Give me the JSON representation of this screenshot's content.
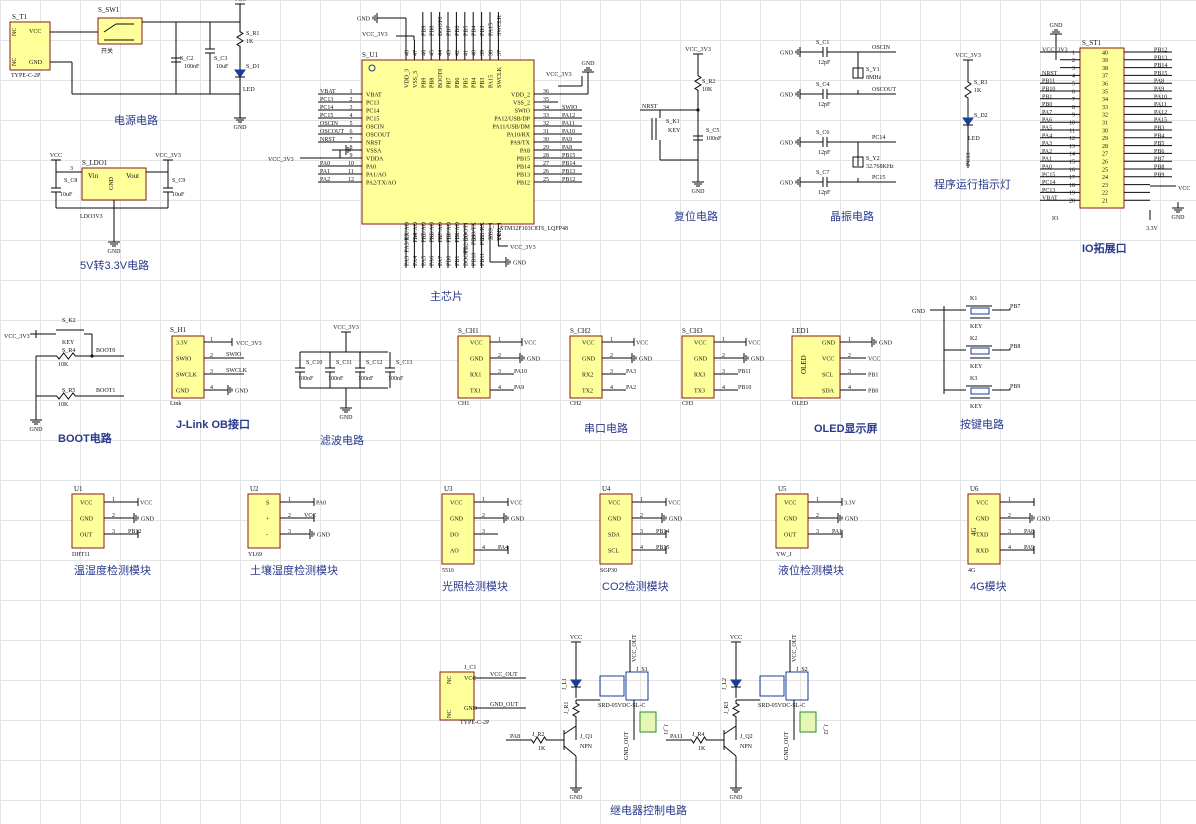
{
  "nets": {
    "vcc": "VCC",
    "vcc33": "VCC_3V3",
    "gnd": "GND",
    "v33": "3.3V",
    "vcc_out": "VCC_OUT",
    "gnd_out": "GND_OUT",
    "nrst": "NRST",
    "boot0": "BOOT0",
    "boot1": "BOOT1",
    "oscin": "OSCIN",
    "oscout": "OSCOUT",
    "pc14": "PC14",
    "pc15": "PC15"
  },
  "titles": {
    "power": "电源电路",
    "ldo": "5V转3.3V电路",
    "main": "主芯片",
    "reset": "复位电路",
    "crystal": "晶振电路",
    "led": "程序运行指示灯",
    "io": "IO拓展口",
    "boot": "BOOT电路",
    "jlink": "J-Link OB接口",
    "filter": "滤波电路",
    "uart": "串口电路",
    "oled": "OLED显示屏",
    "keys": "按键电路",
    "dht": "温湿度检测模块",
    "soil": "土壤湿度检测模块",
    "light": "光照检测模块",
    "co2": "CO2检测模块",
    "level": "液位检测模块",
    "g4": "4G模块",
    "relay": "继电器控制电路"
  },
  "power": {
    "t1": "S_T1",
    "t1_type": "TYPE-C-2P",
    "t1_pins": [
      "NC",
      "VCC",
      "NC",
      "GND"
    ],
    "sw1": "S_SW1",
    "sw1_label": "开关",
    "c2": "S_C2",
    "c2_val": "100nF",
    "c3": "S_C3",
    "c3_val": "10uF",
    "r1": "S_R1",
    "r1_val": "1K",
    "d1": "S_D1",
    "d1_val": "LED"
  },
  "ldo": {
    "u": "S_LDO1",
    "name": "LDO3V3",
    "vin": "Vin",
    "vout": "Vout",
    "gnd": "GND",
    "c8": "S_C8",
    "c9": "S_C9",
    "cval": "10uF"
  },
  "mcu": {
    "ref": "S_U1",
    "part": "STM32F103C8T6_LQFP48",
    "left_pins": [
      "VBAT",
      "PC13",
      "PC14",
      "PC15",
      "OSCIN",
      "OSCOUT",
      "NRST",
      "VSSA",
      "VDDA",
      "PA0",
      "PA1/AO",
      "PA2/TX/AO"
    ],
    "left_nets": [
      "VBAT",
      "PC13",
      "PC14",
      "PC15",
      "OSCIN",
      "OSCOUT",
      "NRST",
      "",
      "",
      "PA0",
      "PA1",
      "PA2"
    ],
    "left_nums": [
      "1",
      "2",
      "3",
      "4",
      "5",
      "6",
      "7",
      "8",
      "9",
      "10",
      "11",
      "12"
    ],
    "right_pins": [
      "VDD_2",
      "VSS_2",
      "SWIO",
      "PA12/USB/DP",
      "PA11/USB/DM",
      "PA10/RX",
      "PA9/TX",
      "PA8",
      "PB15",
      "PB14",
      "PB13",
      "PB12"
    ],
    "right_nets": [
      "",
      "",
      "SWIO",
      "PA12",
      "PA11",
      "PA10",
      "PA9",
      "PA8",
      "PB15",
      "PB14",
      "PB13",
      "PB12"
    ],
    "right_nums": [
      "36",
      "35",
      "34",
      "33",
      "32",
      "31",
      "30",
      "29",
      "28",
      "27",
      "26",
      "25"
    ],
    "top_pins": [
      "VDD_3",
      "VSS_3",
      "PB9",
      "PB8",
      "BOOT0",
      "PB7",
      "PB6",
      "PB5",
      "PB4",
      "PB3",
      "PA15",
      "SWCLK"
    ],
    "top_nets": [
      "",
      "",
      "PB9",
      "PB8",
      "BOOT0",
      "PB7",
      "PB6",
      "PB5",
      "PB4",
      "PB3",
      "PA15",
      "SWCLK"
    ],
    "top_nums": [
      "48",
      "47",
      "46",
      "45",
      "44",
      "43",
      "42",
      "41",
      "40",
      "39",
      "38",
      "37"
    ],
    "bottom_pins": [
      "PA3/RX/AO",
      "PA4/AO",
      "PA5/AO",
      "PA6/AO",
      "PA7/AO",
      "PB0/AO",
      "PB1/AO",
      "PB2/BOOT1",
      "PB10/TX",
      "PB11/RX",
      "VSS_1",
      "VDD_1"
    ],
    "bottom_nets": [
      "PA3",
      "PA4",
      "PA5",
      "PA6",
      "PA7",
      "PB0",
      "PB1",
      "BOOT1",
      "PB10",
      "PB11",
      "",
      ""
    ],
    "bottom_nums": [
      "13",
      "14",
      "15",
      "16",
      "17",
      "18",
      "19",
      "20",
      "21",
      "22",
      "23",
      "24"
    ]
  },
  "reset": {
    "r2": "S_R2",
    "r2_val": "10K",
    "k1": "S_K1",
    "k1_val": "KEY",
    "c5": "S_C5",
    "c5_val": "100nF"
  },
  "crystal": {
    "c1": "S_C1",
    "c4": "S_C4",
    "c6": "S_C6",
    "c7": "S_C7",
    "cval": "12pF",
    "y1": "S_Y1",
    "y1_val": "8MHz",
    "y2": "S_Y2",
    "y2_val": "32.768KHz"
  },
  "ledrun": {
    "r3": "S_R3",
    "r3_val": "1K",
    "d2": "S_D2",
    "d2_val": "LED",
    "net": "PC13"
  },
  "io": {
    "ref": "S_ST1",
    "label": "IO",
    "left_nets": [
      "VCC_3V3",
      "",
      "",
      "NRST",
      "PB11",
      "PB10",
      "PB1",
      "PB0",
      "PA7",
      "PA6",
      "PA5",
      "PA4",
      "PA3",
      "PA2",
      "PA1",
      "PA0",
      "PC15",
      "PC14",
      "PC13",
      "VBAT"
    ],
    "left_nums": [
      "1",
      "2",
      "3",
      "4",
      "5",
      "6",
      "7",
      "8",
      "9",
      "10",
      "11",
      "12",
      "13",
      "14",
      "15",
      "16",
      "17",
      "18",
      "19",
      "20"
    ],
    "right_nums": [
      "40",
      "39",
      "38",
      "37",
      "36",
      "35",
      "34",
      "33",
      "32",
      "31",
      "30",
      "29",
      "28",
      "27",
      "26",
      "25",
      "24",
      "23",
      "22",
      "21"
    ],
    "right_nets": [
      "PB12",
      "PB13",
      "PB14",
      "PB15",
      "PA8",
      "PA9",
      "PA10",
      "PA11",
      "PA12",
      "PA15",
      "PB3",
      "PB4",
      "PB5",
      "PB6",
      "PB7",
      "PB8",
      "PB9",
      "",
      "",
      ""
    ],
    "vcc": "VCC",
    "v33": "3.3V"
  },
  "boot": {
    "k2": "S_K2",
    "k2_val": "KEY",
    "r4": "S_R4",
    "r5": "S_R5",
    "rval": "10K"
  },
  "jlink": {
    "ref": "S_H1",
    "name": "Link",
    "pins": [
      "3.3V",
      "SWIO",
      "SWCLK",
      "GND"
    ],
    "nums": [
      "1",
      "2",
      "3",
      "4"
    ],
    "nets": [
      "VCC_3V3",
      "SWIO",
      "SWCLK",
      "GND"
    ]
  },
  "filter": {
    "caps": [
      "S_C10",
      "S_C11",
      "S_C12",
      "S_C13"
    ],
    "val": "100nF"
  },
  "uart": [
    {
      "ref": "S_CH1",
      "name": "CH1",
      "pins": [
        "VCC",
        "GND",
        "RX1",
        "TX1"
      ],
      "nets": [
        "VCC",
        "GND",
        "PA10",
        "PA9"
      ]
    },
    {
      "ref": "S_CH2",
      "name": "CH2",
      "pins": [
        "VCC",
        "GND",
        "RX2",
        "TX2"
      ],
      "nets": [
        "VCC",
        "GND",
        "PA3",
        "PA2"
      ]
    },
    {
      "ref": "S_CH3",
      "name": "CH3",
      "pins": [
        "VCC",
        "GND",
        "RX3",
        "TX3"
      ],
      "nets": [
        "VCC",
        "GND",
        "PB11",
        "PB10"
      ]
    }
  ],
  "oledm": {
    "ref": "LED1",
    "name": "OLED",
    "label": "OLED",
    "pins": [
      "GND",
      "VCC",
      "SCL",
      "SDA"
    ],
    "nets": [
      "GND",
      "VCC",
      "PB1",
      "PB0"
    ]
  },
  "keys": {
    "items": [
      {
        "ref": "K1",
        "val": "KEY",
        "net": "PB7"
      },
      {
        "ref": "K2",
        "val": "KEY",
        "net": "PB8"
      },
      {
        "ref": "K3",
        "val": "KEY",
        "net": "PB9"
      }
    ]
  },
  "sensors": [
    {
      "ref": "U1",
      "name": "DHT11",
      "pins": [
        "VCC",
        "GND",
        "OUT"
      ],
      "nets": [
        "VCC",
        "GND",
        "PB12"
      ]
    },
    {
      "ref": "U2",
      "name": "YL69",
      "pins": [
        "S",
        "+",
        "-"
      ],
      "nets": [
        "PA0",
        "VCC",
        "GND"
      ]
    },
    {
      "ref": "U3",
      "name": "5516",
      "pins": [
        "VCC",
        "GND",
        "DO",
        "AO"
      ],
      "nets": [
        "VCC",
        "GND",
        "",
        "PA4"
      ]
    },
    {
      "ref": "U4",
      "name": "SGP30",
      "pins": [
        "VCC",
        "GND",
        "SDA",
        "SCL"
      ],
      "nets": [
        "VCC",
        "GND",
        "PB14",
        "PB15"
      ]
    },
    {
      "ref": "U5",
      "name": "YW_J",
      "pins": [
        "VCC",
        "GND",
        "OUT"
      ],
      "nets": [
        "3.3V",
        "GND",
        "PA1"
      ]
    },
    {
      "ref": "U6",
      "name": "4G",
      "label": "4G",
      "pins": [
        "VCC",
        "GND",
        "TXD",
        "RXD"
      ],
      "nets": [
        "",
        "GND",
        "PA8",
        "PA9"
      ]
    }
  ],
  "relay": {
    "c1": "J_C1",
    "c1_type": "TYPE-C-2P",
    "q1": "J_Q1",
    "q2": "J_Q2",
    "npn": "NPN",
    "r2": "J_R2",
    "r4": "J_R4",
    "rval": "1K",
    "s1": "J_S1",
    "s2": "J_S2",
    "relay_part": "SRD-05VDC-SL-C",
    "l1": "J_L1",
    "l2": "J_L2",
    "r1": "J_R1",
    "r3": "J_R3",
    "j1": "J_J1",
    "j2": "J_J2",
    "in1": "PA8",
    "in2": "PA11"
  }
}
